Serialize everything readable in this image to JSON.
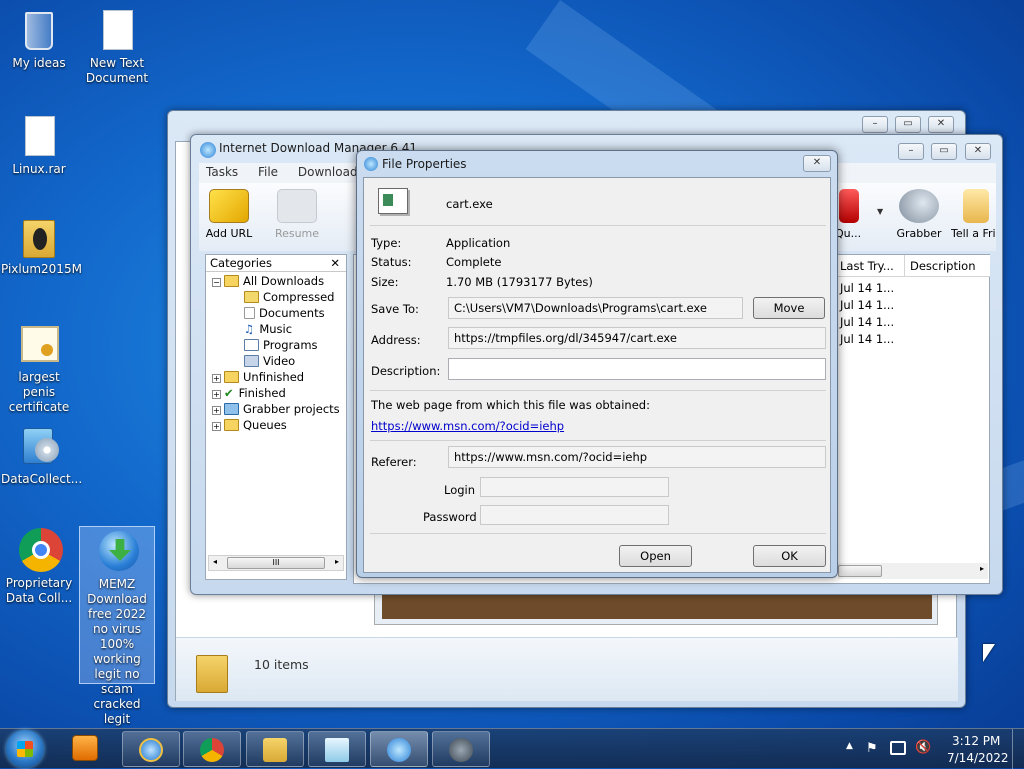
{
  "desktop": {
    "icons": [
      {
        "label": "My ideas"
      },
      {
        "label": "New Text Document"
      },
      {
        "label": "Linux.rar"
      },
      {
        "label": "Pixlum2015M"
      },
      {
        "label": "largest penis certificate"
      },
      {
        "label": "DataCollect..."
      },
      {
        "label": "Proprietary Data Coll..."
      },
      {
        "label": "MEMZ Download free 2022 no virus 100% working legit no scam cracked legit"
      }
    ]
  },
  "explorer": {
    "status_items": "10 items"
  },
  "idm": {
    "title": "Internet Download Manager 6.41",
    "menu": [
      "Tasks",
      "File",
      "Downloads"
    ],
    "toolbar": {
      "add_url": "Add URL",
      "resume": "Resume",
      "queues": "Qu...",
      "grabber": "Grabber",
      "tell_friend": "Tell a Fri"
    },
    "categories_header": "Categories",
    "tree": {
      "all_downloads": "All Downloads",
      "compressed": "Compressed",
      "documents": "Documents",
      "music": "Music",
      "programs": "Programs",
      "video": "Video",
      "unfinished": "Unfinished",
      "finished": "Finished",
      "grabber_projects": "Grabber projects",
      "queues": "Queues"
    },
    "columns": {
      "last_try": "Last Try...",
      "description": "Description"
    },
    "rows": [
      "Jul 14 1...",
      "Jul 14 1...",
      "Jul 14 1...",
      "Jul 14 1..."
    ],
    "scroll_thumb": "III"
  },
  "dialog": {
    "title": "File Properties",
    "filename": "cart.exe",
    "type_label": "Type:",
    "type_value": "Application",
    "status_label": "Status:",
    "status_value": "Complete",
    "size_label": "Size:",
    "size_value": "1.70  MB (1793177 Bytes)",
    "save_to_label": "Save To:",
    "save_to_value": "C:\\Users\\VM7\\Downloads\\Programs\\cart.exe",
    "move_button": "Move",
    "address_label": "Address:",
    "address_value": "https://tmpfiles.org/dl/345947/cart.exe",
    "description_label": "Description:",
    "description_value": "",
    "webpage_label": "The web page from which this file was obtained:",
    "webpage_link": "https://www.msn.com/?ocid=iehp",
    "referer_label": "Referer:",
    "referer_value": "https://www.msn.com/?ocid=iehp",
    "login_label": "Login",
    "password_label": "Password",
    "open_button": "Open",
    "ok_button": "OK"
  },
  "taskbar": {
    "time": "3:12 PM",
    "date": "7/14/2022"
  },
  "colors": {
    "accent": "#0a5bc4",
    "link": "#0000cc"
  }
}
